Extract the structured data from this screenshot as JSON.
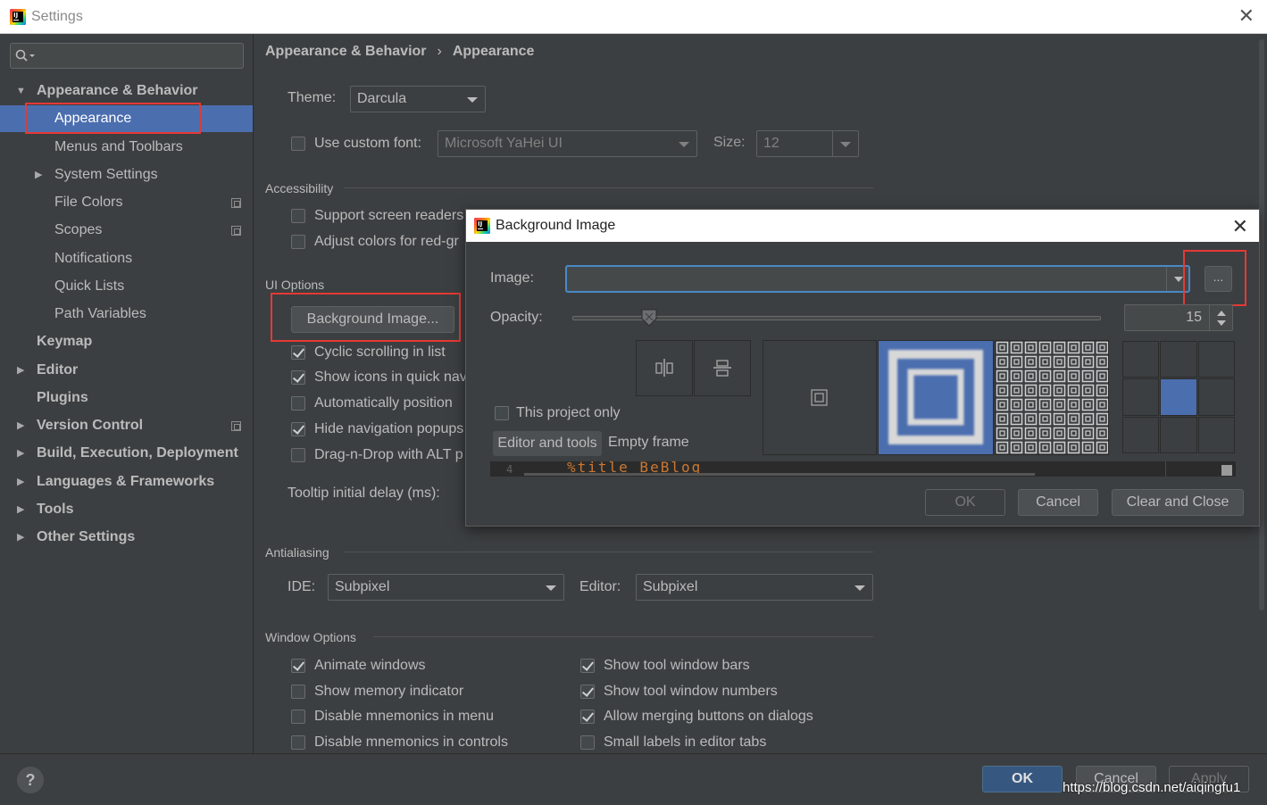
{
  "window": {
    "title": "Settings"
  },
  "search": {
    "placeholder": ""
  },
  "sidebar": {
    "items": [
      {
        "label": "Appearance & Behavior"
      },
      {
        "label": "Appearance"
      },
      {
        "label": "Menus and Toolbars"
      },
      {
        "label": "System Settings"
      },
      {
        "label": "File Colors"
      },
      {
        "label": "Scopes"
      },
      {
        "label": "Notifications"
      },
      {
        "label": "Quick Lists"
      },
      {
        "label": "Path Variables"
      },
      {
        "label": "Keymap"
      },
      {
        "label": "Editor"
      },
      {
        "label": "Plugins"
      },
      {
        "label": "Version Control"
      },
      {
        "label": "Build, Execution, Deployment"
      },
      {
        "label": "Languages & Frameworks"
      },
      {
        "label": "Tools"
      },
      {
        "label": "Other Settings"
      }
    ]
  },
  "breadcrumb": {
    "first": "Appearance & Behavior",
    "separator": "›",
    "second": "Appearance"
  },
  "theme": {
    "label": "Theme:",
    "value": "Darcula"
  },
  "font": {
    "checkbox_label": "Use custom font:",
    "value": "Microsoft YaHei UI",
    "size_label": "Size:",
    "size_value": "12"
  },
  "accessibility": {
    "title": "Accessibility",
    "items": [
      {
        "label": "Support screen readers",
        "checked": false
      },
      {
        "label": "Adjust colors for red-gr",
        "checked": false
      }
    ]
  },
  "ui_options": {
    "title": "UI Options",
    "background_button": "Background Image...",
    "items": [
      {
        "label": "Cyclic scrolling in list",
        "checked": true
      },
      {
        "label": "Show icons in quick nav",
        "checked": true
      },
      {
        "label": "Automatically position",
        "checked": false
      },
      {
        "label": "Hide navigation popups",
        "checked": true
      },
      {
        "label": "Drag-n-Drop with ALT p",
        "checked": false
      }
    ],
    "tooltip_label": "Tooltip initial delay (ms):"
  },
  "antialiasing": {
    "title": "Antialiasing",
    "ide_label": "IDE:",
    "ide_value": "Subpixel",
    "editor_label": "Editor:",
    "editor_value": "Subpixel"
  },
  "window_options": {
    "title": "Window Options",
    "left": [
      {
        "label": "Animate windows",
        "checked": true
      },
      {
        "label": "Show memory indicator",
        "checked": false
      },
      {
        "label": "Disable mnemonics in menu",
        "checked": false
      },
      {
        "label": "Disable mnemonics in controls",
        "checked": false
      }
    ],
    "right": [
      {
        "label": "Show tool window bars",
        "checked": true
      },
      {
        "label": "Show tool window numbers",
        "checked": true
      },
      {
        "label": "Allow merging buttons on dialogs",
        "checked": true
      },
      {
        "label": "Small labels in editor tabs",
        "checked": false
      }
    ]
  },
  "bottom": {
    "help": "?",
    "ok": "OK",
    "cancel": "Cancel",
    "apply": "Apply"
  },
  "watermark": "https://blog.csdn.net/aiqingfu1",
  "dialog": {
    "title": "Background Image",
    "image_label": "Image:",
    "image_value": "",
    "browse": "...",
    "opacity_label": "Opacity:",
    "opacity_value": "15",
    "opacity_fraction": 0.15,
    "this_project_only": "This project only",
    "tab_selected": "Editor and tools",
    "tab_other": "Empty frame",
    "preview_line_number": "4",
    "preview_code": "%title BeBlog",
    "ok": "OK",
    "cancel": "Cancel",
    "clear_close": "Clear and Close"
  },
  "colors": {
    "selection": "#4b6eaf",
    "highlight": "#e53935",
    "focus": "#4a88c7",
    "code_keyword": "#cc7832"
  }
}
